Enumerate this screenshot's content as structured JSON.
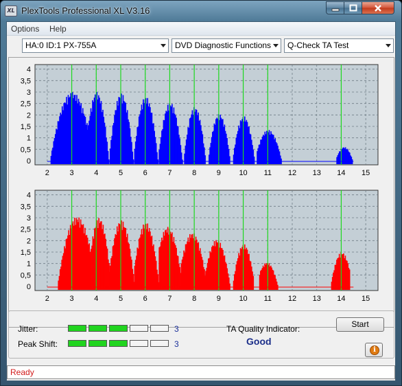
{
  "window": {
    "title": "PlexTools Professional XL V3.16",
    "icon_label": "XL",
    "minimize_icon": "minimize-icon",
    "maximize_icon": "maximize-icon",
    "close_icon": "close-icon"
  },
  "menu": {
    "items": [
      "Options",
      "Help"
    ]
  },
  "selectors": {
    "drive": "HA:0 ID:1  PX-755A",
    "function": "DVD Diagnostic Functions",
    "test": "Q-Check TA Test"
  },
  "colors": {
    "plot_bg": "#c4cfd6",
    "series_top": "#0000ff",
    "series_bottom": "#ff0000",
    "marker": "#1ed81e",
    "status": "#d21a1a"
  },
  "chart_data": [
    {
      "type": "bar",
      "x_ticks": [
        "2",
        "3",
        "4",
        "5",
        "6",
        "7",
        "8",
        "9",
        "10",
        "11",
        "12",
        "13",
        "14",
        "15"
      ],
      "y_ticks": [
        "0",
        "0,5",
        "1",
        "1,5",
        "2",
        "2,5",
        "3",
        "3,5",
        "4"
      ],
      "xlim": [
        1.5,
        15.5
      ],
      "ylim": [
        0,
        4.2
      ],
      "grid": true,
      "markers": [
        3,
        4,
        5,
        6,
        7,
        8,
        9,
        10,
        11,
        14
      ],
      "peaks": [
        {
          "center": 3.0,
          "height": 3.0,
          "from": 2.1,
          "to": 3.9
        },
        {
          "center": 4.0,
          "height": 3.0,
          "from": 3.55,
          "to": 4.5
        },
        {
          "center": 5.0,
          "height": 2.95,
          "from": 4.55,
          "to": 5.5
        },
        {
          "center": 6.0,
          "height": 2.8,
          "from": 5.55,
          "to": 6.5
        },
        {
          "center": 7.0,
          "height": 2.55,
          "from": 6.55,
          "to": 7.5
        },
        {
          "center": 8.0,
          "height": 2.35,
          "from": 7.55,
          "to": 8.45
        },
        {
          "center": 9.0,
          "height": 2.05,
          "from": 8.55,
          "to": 9.45
        },
        {
          "center": 10.0,
          "height": 1.95,
          "from": 9.55,
          "to": 10.45
        },
        {
          "center": 11.0,
          "height": 1.35,
          "from": 10.55,
          "to": 11.55
        },
        {
          "center": 14.1,
          "height": 0.6,
          "from": 13.8,
          "to": 14.45
        }
      ]
    },
    {
      "type": "bar",
      "x_ticks": [
        "2",
        "3",
        "4",
        "5",
        "6",
        "7",
        "8",
        "9",
        "10",
        "11",
        "12",
        "13",
        "14",
        "15"
      ],
      "y_ticks": [
        "0",
        "0,5",
        "1",
        "1,5",
        "2",
        "2,5",
        "3",
        "3,5",
        "4"
      ],
      "xlim": [
        1.5,
        15.5
      ],
      "ylim": [
        0,
        4.2
      ],
      "grid": true,
      "markers": [
        3,
        4,
        5,
        6,
        7,
        8,
        9,
        10,
        11,
        14
      ],
      "peaks": [
        {
          "center": 3.2,
          "height": 3.05,
          "from": 2.4,
          "to": 3.75
        },
        {
          "center": 4.1,
          "height": 3.0,
          "from": 3.7,
          "to": 4.6
        },
        {
          "center": 5.0,
          "height": 2.9,
          "from": 4.55,
          "to": 5.55
        },
        {
          "center": 6.0,
          "height": 2.8,
          "from": 5.55,
          "to": 6.55
        },
        {
          "center": 6.9,
          "height": 2.6,
          "from": 6.55,
          "to": 7.5
        },
        {
          "center": 7.9,
          "height": 2.35,
          "from": 7.45,
          "to": 8.5
        },
        {
          "center": 8.9,
          "height": 2.05,
          "from": 8.45,
          "to": 9.45
        },
        {
          "center": 10.0,
          "height": 1.85,
          "from": 9.55,
          "to": 10.4
        },
        {
          "center": 10.95,
          "height": 1.05,
          "from": 10.65,
          "to": 11.4
        },
        {
          "center": 14.0,
          "height": 1.5,
          "from": 13.55,
          "to": 14.35
        }
      ]
    }
  ],
  "metrics": {
    "jitter_label": "Jitter:",
    "jitter_value": "3",
    "jitter_level": 3,
    "peak_label": "Peak Shift:",
    "peak_value": "3",
    "peak_level": 3,
    "segments_total": 5
  },
  "quality": {
    "label": "TA Quality Indicator:",
    "value": "Good"
  },
  "buttons": {
    "start": "Start",
    "info_icon": "info-icon",
    "info_glyph": "i"
  },
  "status": {
    "text": "Ready"
  }
}
